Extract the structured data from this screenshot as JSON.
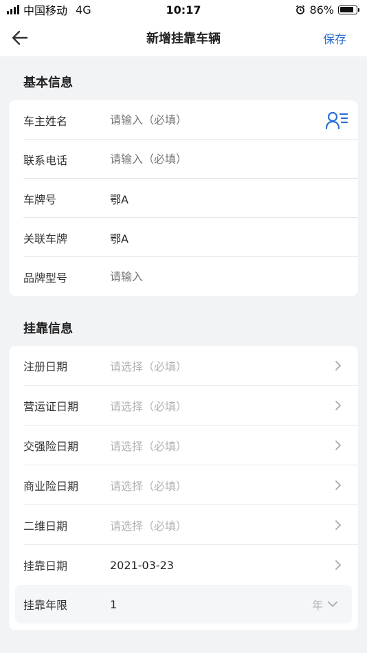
{
  "status_bar": {
    "carrier": "中国移动",
    "network": "4G",
    "time": "10:17",
    "battery": "86%",
    "battery_level": 0.86
  },
  "nav": {
    "title": "新增挂靠车辆",
    "save_label": "保存",
    "back_icon": "arrow-left-icon"
  },
  "basic_info": {
    "title": "基本信息",
    "rows": [
      {
        "label": "车主姓名",
        "value": "",
        "placeholder": "请输入（必填）",
        "icon": "contact-list-icon"
      },
      {
        "label": "联系电话",
        "value": "",
        "placeholder": "请输入（必填）"
      },
      {
        "label": "车牌号",
        "value": "鄂A",
        "placeholder": ""
      },
      {
        "label": "关联车牌",
        "value": "鄂A",
        "placeholder": ""
      },
      {
        "label": "品牌型号",
        "value": "",
        "placeholder": "请输入"
      }
    ]
  },
  "affiliation_info": {
    "title": "挂靠信息",
    "rows": [
      {
        "label": "注册日期",
        "value": "请选择（必填）",
        "is_placeholder": true
      },
      {
        "label": "营运证日期",
        "value": "请选择（必填）",
        "is_placeholder": true
      },
      {
        "label": "交强险日期",
        "value": "请选择（必填）",
        "is_placeholder": true
      },
      {
        "label": "商业险日期",
        "value": "请选择（必填）",
        "is_placeholder": true
      },
      {
        "label": "二维日期",
        "value": "请选择（必填）",
        "is_placeholder": true
      },
      {
        "label": "挂靠日期",
        "value": "2021-03-23",
        "is_placeholder": false
      }
    ],
    "term": {
      "label": "挂靠年限",
      "value": "1",
      "unit": "年"
    }
  },
  "colors": {
    "accent": "#2b6fd6",
    "background": "#f2f3f5",
    "card": "#ffffff",
    "placeholder": "#b3b3b3"
  }
}
